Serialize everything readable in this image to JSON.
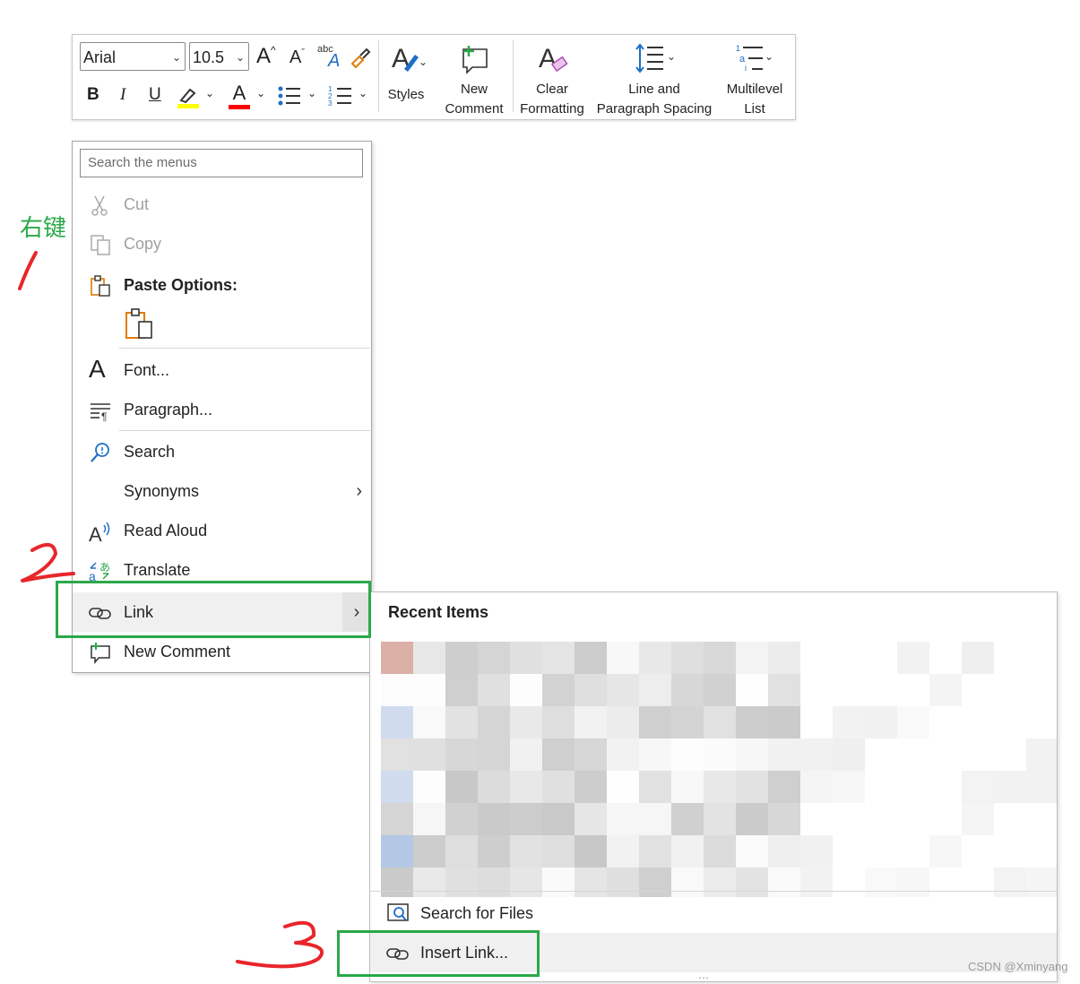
{
  "toolbar": {
    "font_name": "Arial",
    "font_size": "10.5",
    "buttons": {
      "styles": "Styles",
      "new_comment": [
        "New",
        "Comment"
      ],
      "clear_formatting": [
        "Clear",
        "Formatting"
      ],
      "line_spacing": [
        "Line and",
        "Paragraph Spacing"
      ],
      "multilevel_list": [
        "Multilevel",
        "List"
      ]
    },
    "format_glyphs": {
      "bold": "B",
      "italic": "I",
      "underline": "U",
      "font_color": "A",
      "abc": "abc"
    },
    "highlight_color": "#ffff00",
    "font_color_bar": "#ff0000"
  },
  "context_menu": {
    "search_placeholder": "Search the menus",
    "items": {
      "cut": "Cut",
      "copy": "Copy",
      "paste_options": "Paste Options:",
      "font": "Font...",
      "paragraph": "Paragraph...",
      "search": "Search",
      "synonyms": "Synonyms",
      "read_aloud": "Read Aloud",
      "translate": "Translate",
      "link": "Link",
      "new_comment": "New Comment"
    }
  },
  "submenu": {
    "title": "Recent Items",
    "search_files": "Search for Files",
    "insert_link": "Insert Link..."
  },
  "annotations": {
    "right_click_label": "右键",
    "step_numbers": [
      "1",
      "2",
      "3"
    ],
    "box_color": "#2aa84a",
    "pen_color": "#e8262b"
  },
  "watermark": "CSDN @Xminyang"
}
